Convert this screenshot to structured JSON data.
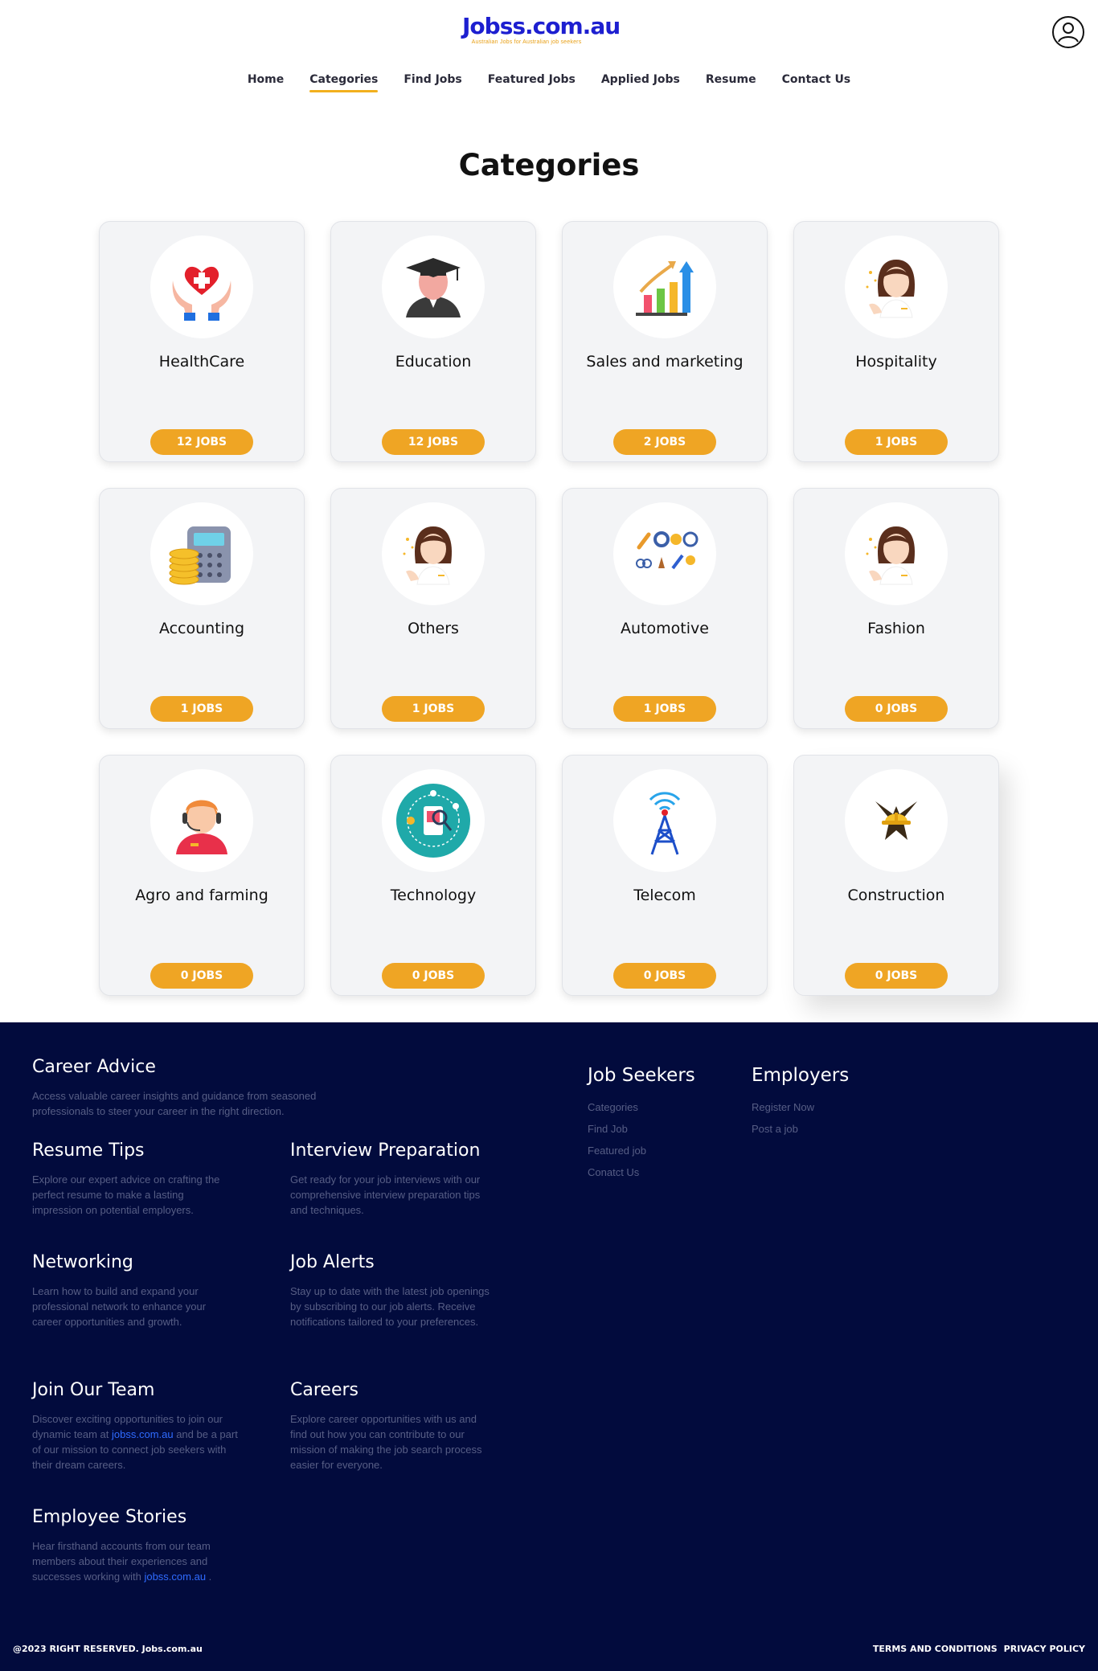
{
  "header": {
    "logo": "Jobss.com.au",
    "tagline": "Australian Jobs for Australian job seekers",
    "nav": [
      "Home",
      "Categories",
      "Find Jobs",
      "Featured Jobs",
      "Applied Jobs",
      "Resume",
      "Contact Us"
    ],
    "active_nav": "Categories"
  },
  "page_title": "Categories",
  "categories": [
    {
      "name": "HealthCare",
      "jobs": "12 JOBS",
      "icon": "healthcare-icon"
    },
    {
      "name": "Education",
      "jobs": "12 JOBS",
      "icon": "graduate-icon"
    },
    {
      "name": "Sales and marketing",
      "jobs": "2 JOBS",
      "icon": "sales-chart-icon"
    },
    {
      "name": "Hospitality",
      "jobs": "1 JOBS",
      "icon": "hostess-icon"
    },
    {
      "name": "Accounting",
      "jobs": "1 JOBS",
      "icon": "calculator-coins-icon"
    },
    {
      "name": "Others",
      "jobs": "1 JOBS",
      "icon": "hostess-icon"
    },
    {
      "name": "Automotive",
      "jobs": "1 JOBS",
      "icon": "car-parts-icon"
    },
    {
      "name": "Fashion",
      "jobs": "0 JOBS",
      "icon": "hostess-icon"
    },
    {
      "name": "Agro and farming",
      "jobs": "0 JOBS",
      "icon": "support-agent-icon"
    },
    {
      "name": "Technology",
      "jobs": "0 JOBS",
      "icon": "tech-circle-icon"
    },
    {
      "name": "Telecom",
      "jobs": "0 JOBS",
      "icon": "radio-tower-icon"
    },
    {
      "name": "Construction",
      "jobs": "0 JOBS",
      "icon": "hard-hat-icon"
    }
  ],
  "footer": {
    "career_advice": {
      "title": "Career Advice",
      "text": "Access valuable career insights and guidance from seasoned professionals to steer your career in the right direction."
    },
    "resume_tips": {
      "title": "Resume Tips",
      "text": "Explore our expert advice on crafting the perfect resume to make a lasting impression on potential employers."
    },
    "interview": {
      "title": "Interview Preparation",
      "text": "Get ready for your job interviews with our comprehensive interview preparation tips and techniques."
    },
    "networking": {
      "title": "Networking",
      "text": "Learn how to build and expand your professional network to enhance your career opportunities and growth."
    },
    "job_alerts": {
      "title": "Job Alerts",
      "text": "Stay up to date with the latest job openings by subscribing to our job alerts. Receive notifications tailored to your preferences."
    },
    "join_team": {
      "title": "Join Our Team",
      "text_before": "Discover exciting opportunities to join our dynamic team at ",
      "link": "jobss.com.au",
      "text_after": " and be a part of our mission to connect job seekers with their dream careers."
    },
    "careers": {
      "title": "Careers",
      "text": "Explore career opportunities with us and find out how you can contribute to our mission of making the job search process easier for everyone."
    },
    "stories": {
      "title": "Employee Stories",
      "text_before": "Hear firsthand accounts from our team members about their experiences and successes working with ",
      "link": "jobss.com.au",
      "text_after": " ."
    },
    "job_seekers": {
      "title": "Job Seekers",
      "links": [
        "Categories",
        "Find Job",
        "Featured job",
        "Conatct Us"
      ]
    },
    "employers": {
      "title": "Employers",
      "links": [
        "Register Now",
        "Post a job"
      ]
    },
    "copyright": "@2023 RIGHT RESERVED. Jobs.com.au",
    "terms": "TERMS AND CONDITIONS",
    "privacy": "PRIVACY POLICY"
  }
}
